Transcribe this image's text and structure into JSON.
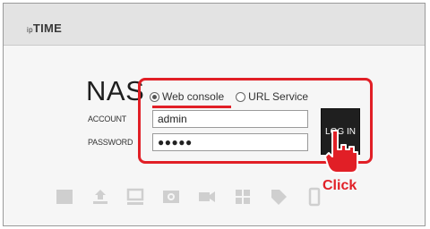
{
  "header": {
    "logo_prefix": "ip",
    "logo_main": "TIME"
  },
  "login": {
    "title": "NAS",
    "options": [
      {
        "label": "Web console",
        "selected": true
      },
      {
        "label": "URL Service",
        "selected": false
      }
    ],
    "account_label": "ACCOUNT",
    "account_value": "admin",
    "password_label": "PASSWORD",
    "password_value": "●●●●●",
    "login_button": "LOG IN"
  },
  "annotation": {
    "click_text": "Click",
    "highlight_color": "#e11f26"
  },
  "icons": [
    "storage-icon",
    "backup-icon",
    "monitor-icon",
    "photo-icon",
    "video-camera-icon",
    "music-icon",
    "tag-icon",
    "phone-icon"
  ]
}
